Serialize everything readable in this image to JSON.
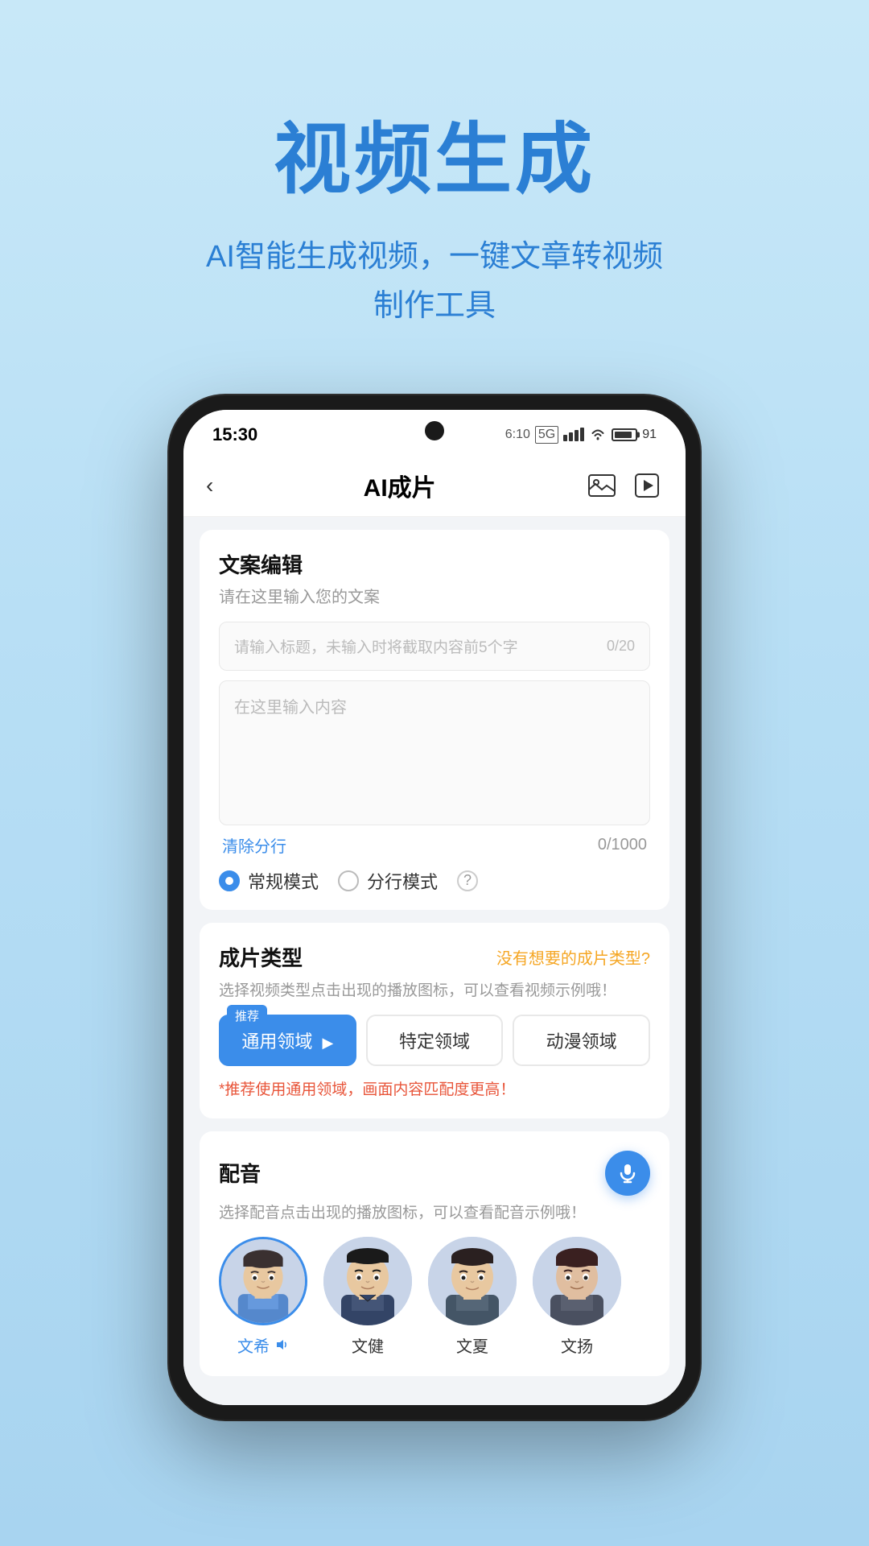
{
  "hero": {
    "title": "视频生成",
    "subtitle_line1": "AI智能生成视频，一键文章转视频",
    "subtitle_line2": "制作工具"
  },
  "phone": {
    "status": {
      "time": "15:30",
      "battery": "91"
    },
    "nav": {
      "back_icon": "‹",
      "title": "AI成片"
    },
    "copywriting": {
      "section_title": "文案编辑",
      "section_desc": "请在这里输入您的文案",
      "title_placeholder": "请输入标题，未输入时将截取内容前5个字",
      "title_counter": "0/20",
      "content_placeholder": "在这里输入内容",
      "clear_btn": "清除分行",
      "content_counter": "0/1000"
    },
    "modes": {
      "normal": "常规模式",
      "split": "分行模式"
    },
    "production_type": {
      "section_title": "成片类型",
      "section_link": "没有想要的成片类型?",
      "section_desc": "选择视频类型点击出现的播放图标，可以查看视频示例哦！",
      "recommend_label": "推荐",
      "btn_general": "通用领域",
      "btn_specific": "特定领域",
      "btn_anime": "动漫领域",
      "note": "*推荐使用通用领域，画面内容匹配度更高！"
    },
    "voice": {
      "section_title": "配音",
      "section_desc": "选择配音点击出现的播放图标，可以查看配音示例哦！",
      "avatars": [
        {
          "name": "文希",
          "active": true
        },
        {
          "name": "文健",
          "active": false
        },
        {
          "name": "文夏",
          "active": false
        },
        {
          "name": "文扬",
          "active": false
        }
      ]
    }
  }
}
